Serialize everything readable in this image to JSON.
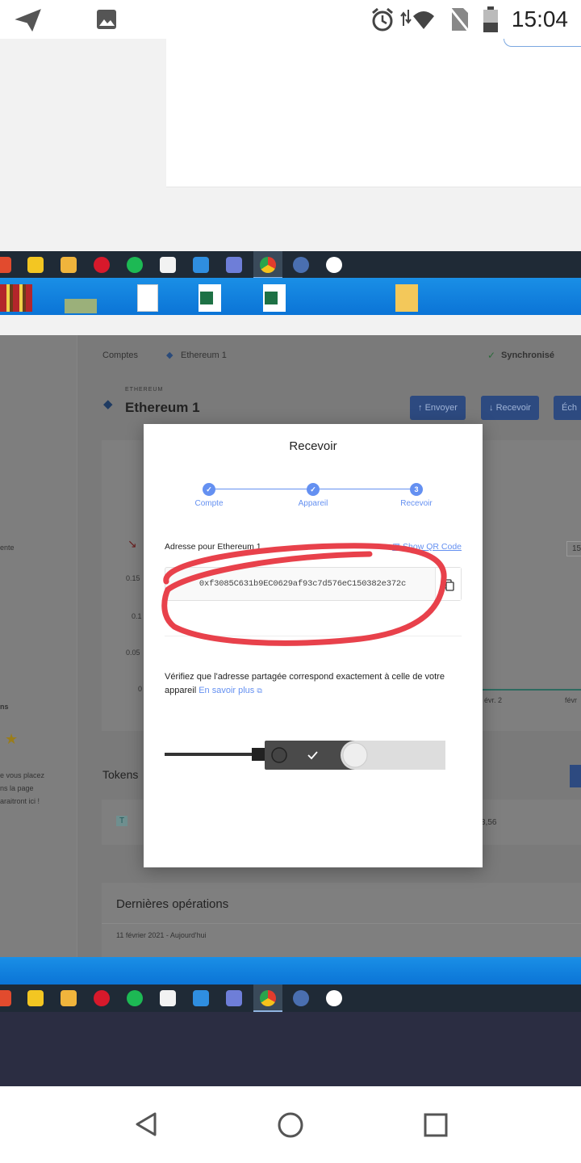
{
  "status_bar": {
    "time": "15:04"
  },
  "app": {
    "breadcrumb_accounts": "Comptes",
    "breadcrumb_account": "Ethereum 1",
    "sync_status": "Synchronisé",
    "currency_tag": "ETHEREUM",
    "account_title": "Ethereum 1",
    "send_button": "Envoyer",
    "receive_button": "Recevoir",
    "exchange_button": "Éch",
    "axis_ticks": [
      "0.15",
      "0.1",
      "0.05",
      "0"
    ],
    "axis_date_right1": "évr. 2",
    "axis_date_right2": "févr",
    "side_text_partial": "ente",
    "side_text_partial2": "ns",
    "side_hint": [
      "e vous placez",
      "ns la page",
      "araitront ici !"
    ],
    "tokens_label": "Tokens",
    "token_value": "3,56",
    "token_letter": "T",
    "last_ops_title": "Dernières opérations",
    "last_ops_date": "11 février 2021 - Aujourd'hui",
    "right_partial": "15"
  },
  "modal": {
    "title": "Recevoir",
    "steps": [
      {
        "label": "Compte",
        "marker": "✓"
      },
      {
        "label": "Appareil",
        "marker": "✓"
      },
      {
        "label": "Recevoir",
        "marker": "3"
      }
    ],
    "address_label": "Adresse pour Ethereum 1",
    "qr_link": "Show QR Code",
    "address": "0xf3085C631b9EC0629af93c7d576eC150382e372c",
    "verify_text": "Vérifiez que l'adresse partagée correspond exactement à celle de votre appareil",
    "learn_more": "En savoir plus"
  },
  "colors": {
    "accent": "#6490f1",
    "scribble": "#e8414b",
    "taskbar": "#1f2a36",
    "overlay": "#7a7a7a"
  }
}
